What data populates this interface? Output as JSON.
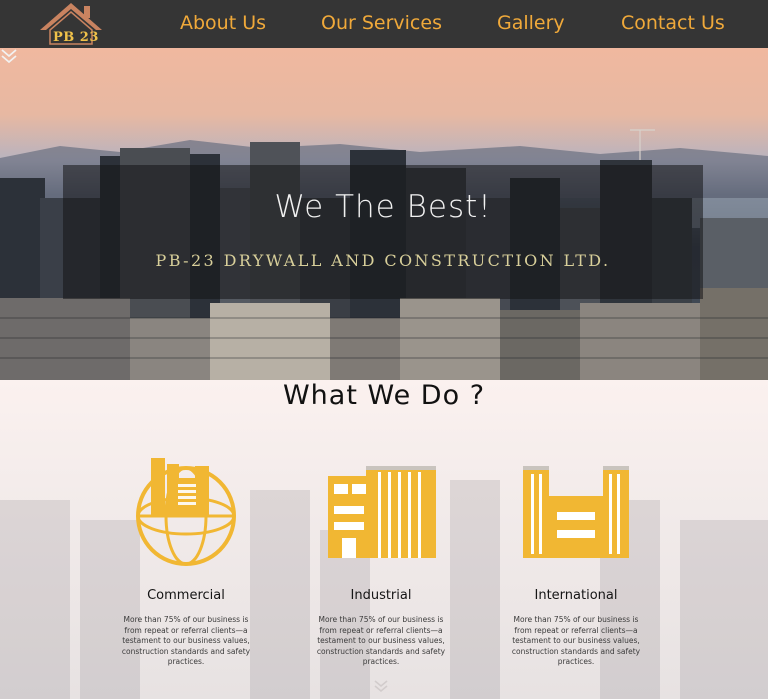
{
  "nav": {
    "logo_text": "PB 23",
    "links": [
      "About Us",
      "Our Services",
      "Gallery",
      "Contact Us"
    ]
  },
  "hero": {
    "title": "We The Best!",
    "subtitle": "PB-23 DRYWALL AND CONSTRUCTION LTD."
  },
  "services": {
    "title": "What We Do ?",
    "cards": [
      {
        "title": "Commercial",
        "icon": "commercial-building-icon",
        "text": "More than 75% of our business is from repeat or referral clients—a testament to our business values, construction standards and safety practices."
      },
      {
        "title": "Industrial",
        "icon": "industrial-building-icon",
        "text": "More than 75% of our business is from repeat or referral clients—a testament to our business values, construction standards and safety practices."
      },
      {
        "title": "International",
        "icon": "international-building-icon",
        "text": "More than 75% of our business is from repeat or referral clients—a testament to our business values, construction standards and safety practices."
      }
    ]
  },
  "colors": {
    "nav_bg": "#353535",
    "nav_link": "#f0a93a",
    "icon_gold": "#f1b733",
    "subtitle_gold": "#d8cf9a"
  }
}
